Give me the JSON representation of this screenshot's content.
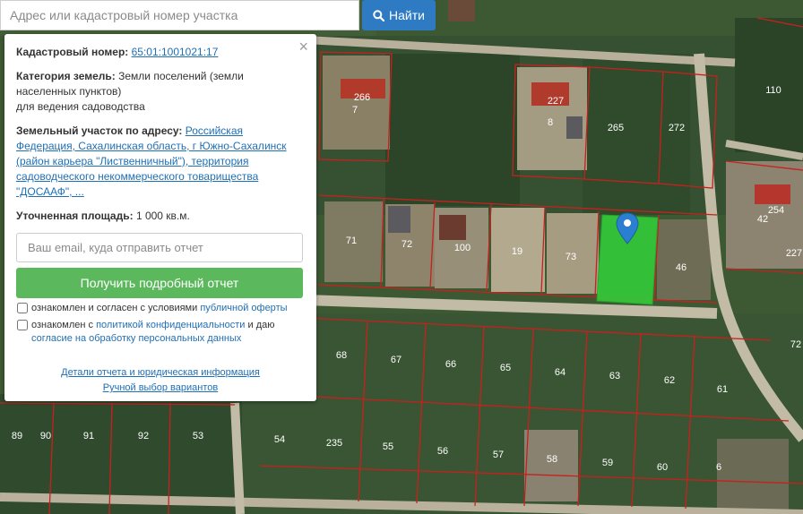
{
  "search": {
    "placeholder": "Адрес или кадастровый номер участка",
    "button_label": "Найти"
  },
  "panel": {
    "close_label": "×",
    "cadastral_label": "Кадастровый номер:",
    "cadastral_value": "65:01:1001021:17",
    "category_label": "Категория земель:",
    "category_value": "Земли поселений (земли населенных пунктов)",
    "category_use": "для ведения садоводства",
    "address_label": "Земельный участок по адресу:",
    "address_value": "Российская Федерация, Сахалинская область, г Южно-Сахалинск (район карьера \"Лиственничный\"), территория садоводческого некоммерческого товарищества \"ДОСААФ\", ...",
    "area_label": "Уточненная площадь:",
    "area_value": "1 000 кв.м.",
    "email_placeholder": "Ваш email, куда отправить отчет",
    "report_button": "Получить подробный отчет",
    "consent1_text": "ознакомлен и согласен с условиями",
    "consent1_link": "публичной оферты",
    "consent2_text": "ознакомлен с",
    "consent2_link": "политикой конфиденциальности",
    "consent2_mid": "и даю",
    "consent2_link2": "согласие на обработку персональных данных",
    "details_link": "Детали отчета и юридическая информация",
    "manual_link": "Ручной выбор вариантов"
  },
  "map": {
    "plot_numbers": [
      "266",
      "7",
      "227",
      "8",
      "265",
      "272",
      "110",
      "254",
      "42",
      "227",
      "71",
      "72",
      "100",
      "19",
      "73",
      "46",
      "68",
      "67",
      "66",
      "65",
      "64",
      "63",
      "62",
      "61",
      "72",
      "89",
      "90",
      "91",
      "92",
      "53",
      "54",
      "235",
      "55",
      "56",
      "57",
      "58",
      "59",
      "60",
      "6"
    ]
  },
  "colors": {
    "accent": "#2e7bc4",
    "report_green": "#5cb85c",
    "selected_plot": "#33d13a",
    "plot_border": "#c8201e",
    "marker": "#2b7fd0"
  }
}
